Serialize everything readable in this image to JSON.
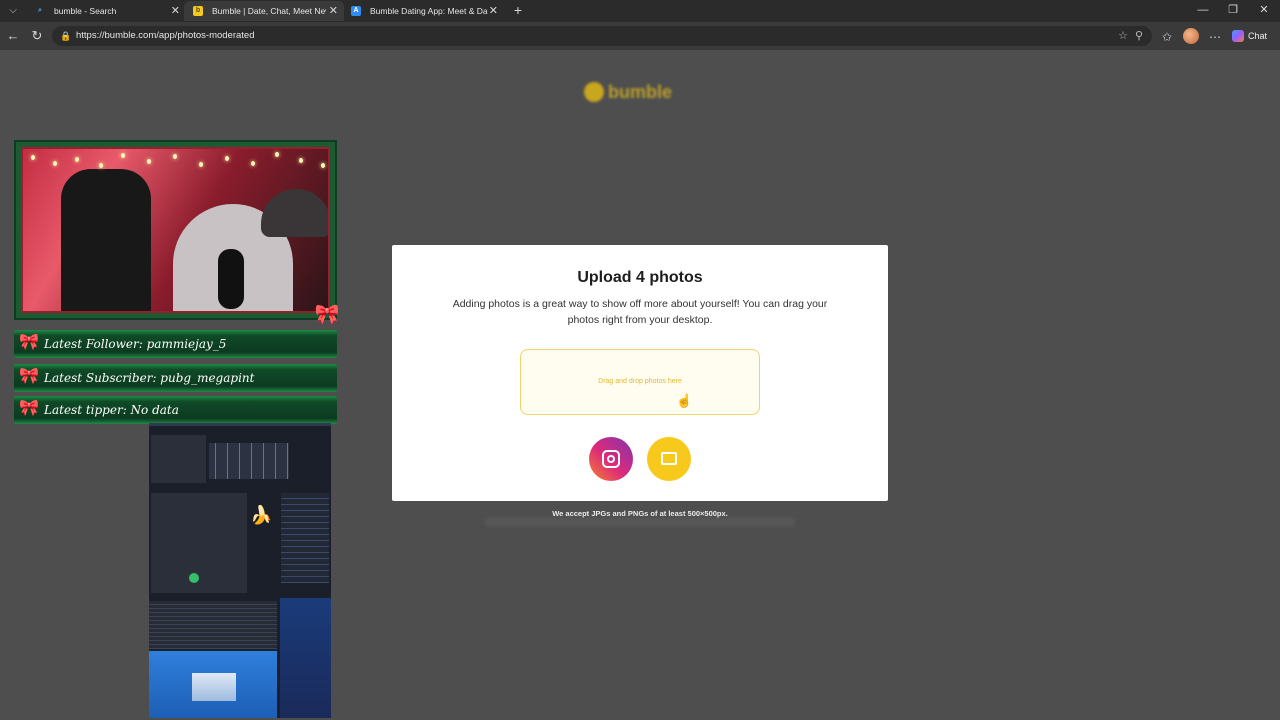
{
  "browser": {
    "tabs": [
      {
        "title": "bumble - Search",
        "active": false,
        "favicon": "search-icon"
      },
      {
        "title": "Bumble | Date, Chat, Meet New P",
        "active": true,
        "favicon": "bumble-icon"
      },
      {
        "title": "Bumble Dating App: Meet & Dat",
        "active": false,
        "favicon": "app-store-icon"
      }
    ],
    "url": "https://bumble.com/app/photos-moderated",
    "chat_label": "Chat"
  },
  "page": {
    "logo_text": "bumble",
    "modal": {
      "title": "Upload 4 photos",
      "description": "Adding photos is a great way to show off more about yourself! You can drag your photos right from your desktop.",
      "dropzone_text": "Drag and drop photos here"
    },
    "note": "We accept JPGs and PNGs of at least 500×500px."
  },
  "overlay": {
    "latest_follower": "Latest Follower: pammiejay_5",
    "latest_subscriber": "Latest Subscriber: pubg_megapint",
    "latest_tipper": "Latest tipper: No data"
  },
  "colors": {
    "accent": "#f8c91d",
    "instagram": "#dd2a7b",
    "backdrop": "#4e4e4e"
  }
}
